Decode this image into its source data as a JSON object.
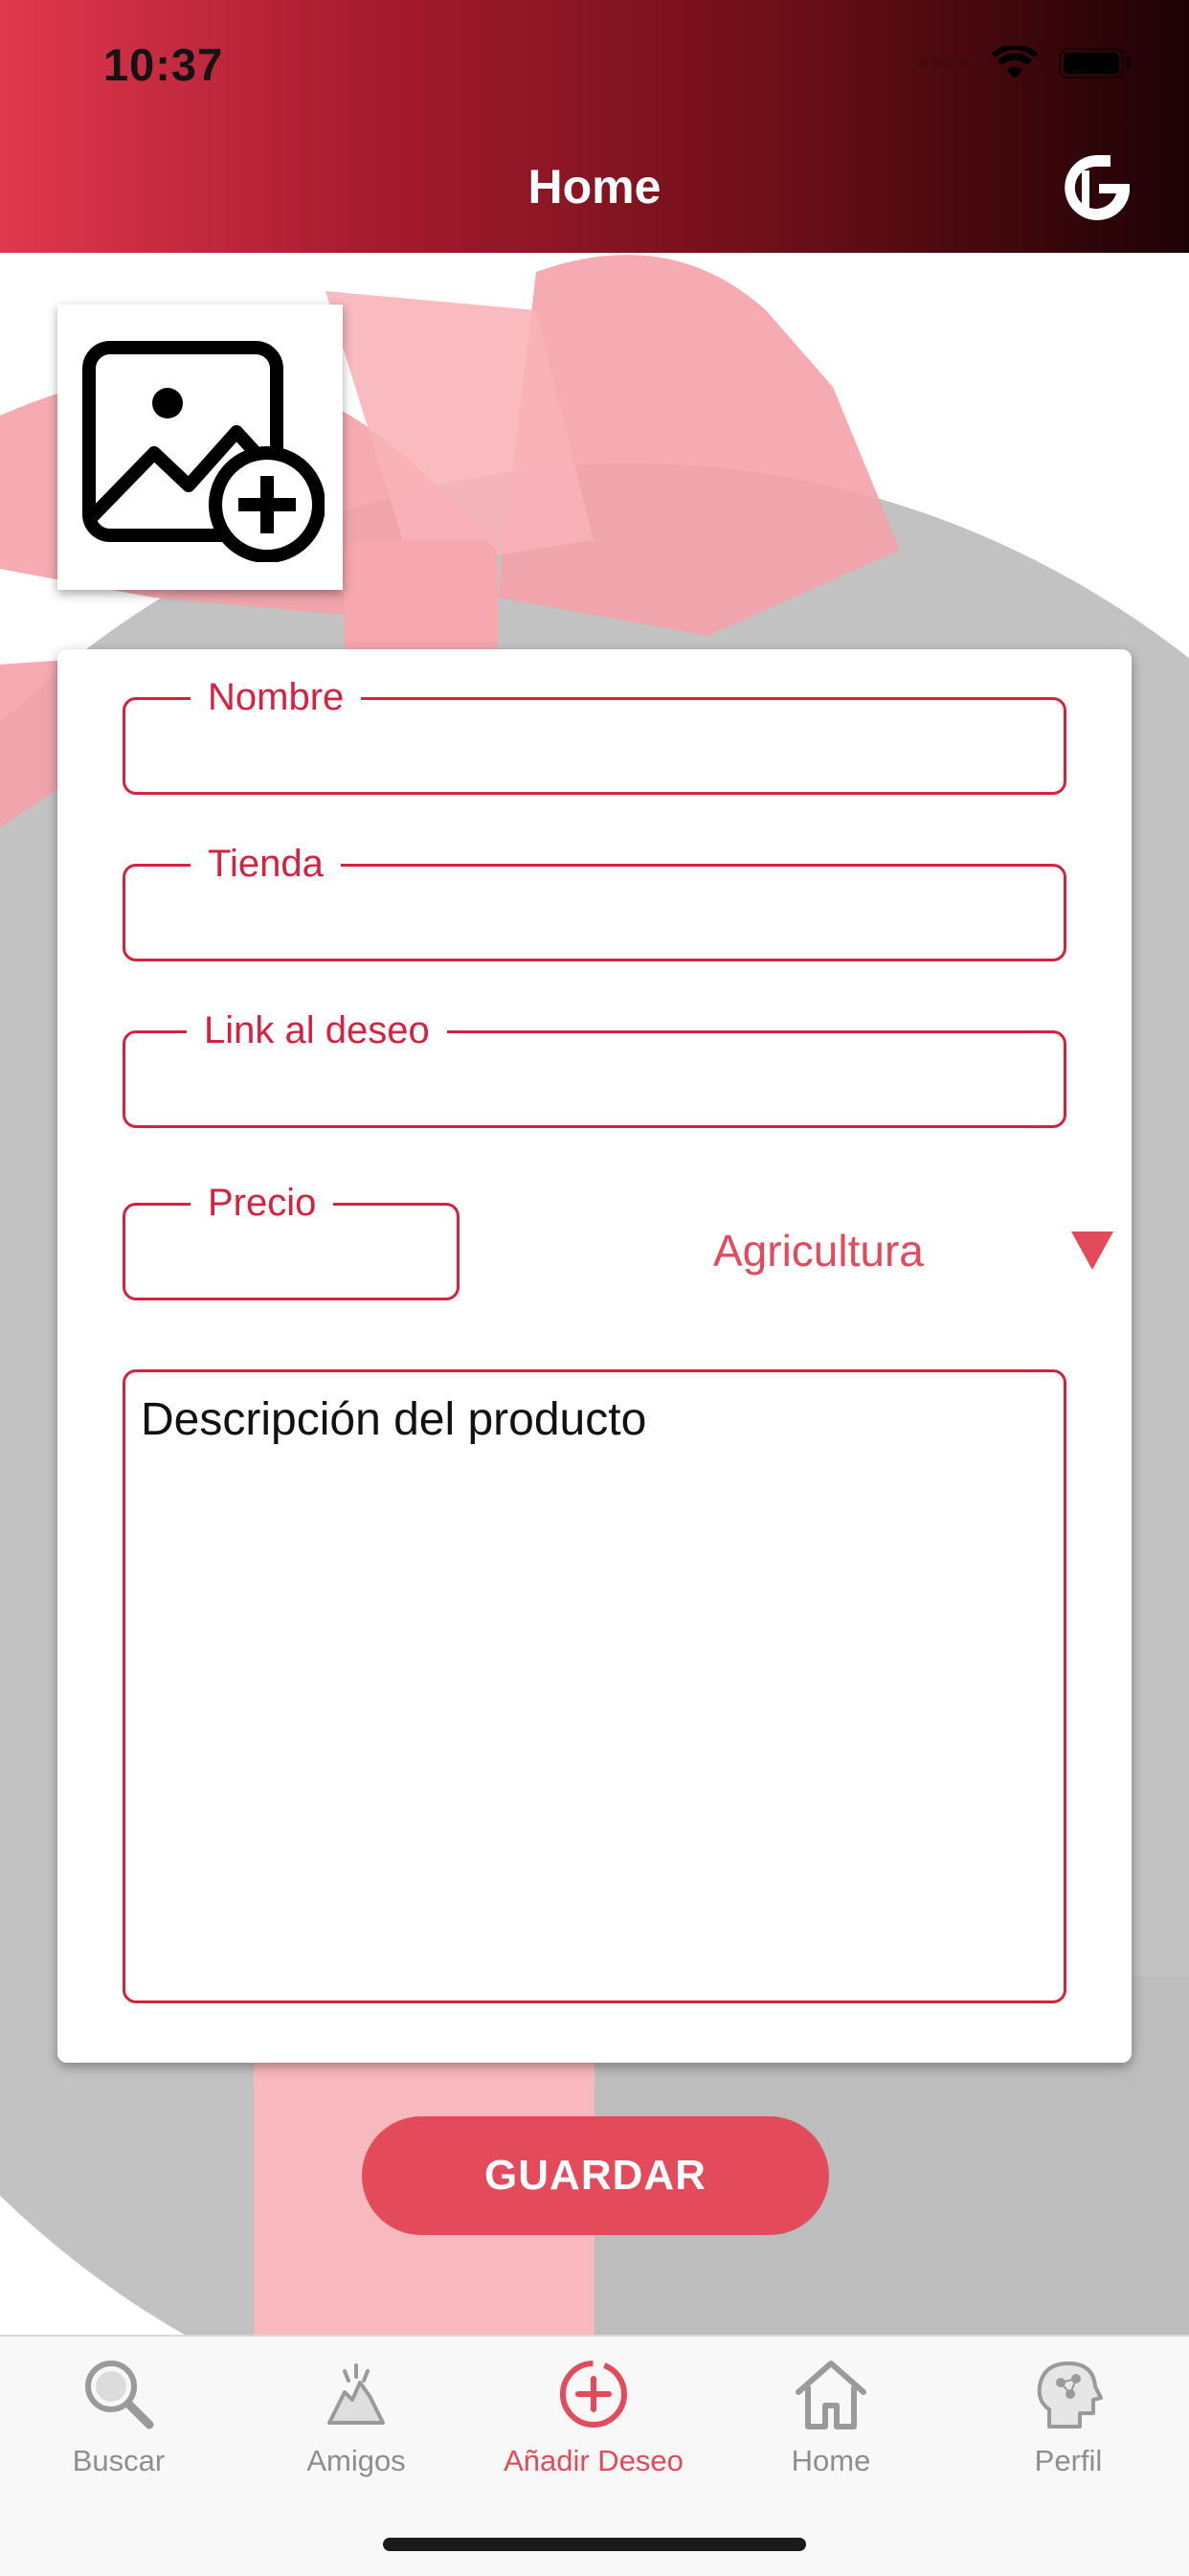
{
  "status_bar": {
    "time": "10:37"
  },
  "header": {
    "title": "Home",
    "logo_icon": "app-logo-icon"
  },
  "image_picker": {
    "icon": "add-image-icon"
  },
  "form": {
    "nombre_label": "Nombre",
    "nombre_value": "",
    "tienda_label": "Tienda",
    "tienda_value": "",
    "link_label": "Link al deseo",
    "link_value": "",
    "precio_label": "Precio",
    "precio_value": "",
    "category_selected": "Agricultura",
    "description_placeholder": "Descripción del producto"
  },
  "save_button": {
    "label": "GUARDAR"
  },
  "tabbar": {
    "items": [
      {
        "label": "Buscar",
        "icon": "search-icon",
        "active": false
      },
      {
        "label": "Amigos",
        "icon": "friends-icon",
        "active": false
      },
      {
        "label": "Añadir Deseo",
        "icon": "add-wish-icon",
        "active": true
      },
      {
        "label": "Home",
        "icon": "home-icon",
        "active": false
      },
      {
        "label": "Perfil",
        "icon": "profile-icon",
        "active": false
      }
    ]
  },
  "colors": {
    "accent": "#e34a5a",
    "field_border": "#d6213f",
    "header_start": "#e0384f",
    "header_end": "#1c0204",
    "inactive_tab": "#8e8e8e"
  }
}
